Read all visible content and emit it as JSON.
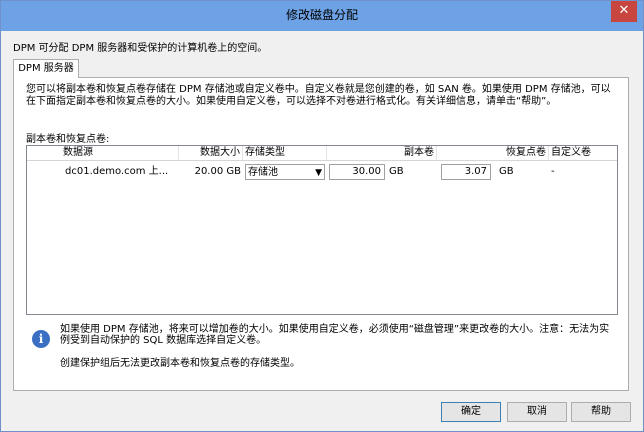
{
  "window": {
    "title": "修改磁盘分配",
    "close_glyph": "✕"
  },
  "description": "DPM 可分配 DPM 服务器和受保护的计算机卷上的空间。",
  "tab": {
    "label": "DPM 服务器"
  },
  "info_paragraph": "您可以将副本卷和恢复点卷存储在 DPM 存储池或自定义卷中。自定义卷就是您创建的卷，如 SAN 卷。如果使用 DPM 存储池，可以在下面指定副本卷和恢复点卷的大小。如果使用自定义卷，可以选择不对卷进行格式化。有关详细信息，请单击“帮助”。",
  "grid": {
    "label": "副本卷和恢复点卷:",
    "columns": [
      "数据源",
      "数据大小",
      "存储类型",
      "副本卷",
      "恢复点卷",
      "自定义卷"
    ],
    "rows": [
      {
        "data_source": "dc01.demo.com 上...",
        "data_size": "20.00 GB",
        "storage_type": "存储池",
        "replica_value": "30.00",
        "replica_unit": "GB",
        "recovery_value": "3.07",
        "recovery_unit": "GB",
        "custom": "-"
      }
    ]
  },
  "notes": {
    "icon": "info-icon",
    "line1": "如果使用 DPM 存储池，将来可以增加卷的大小。如果使用自定义卷，必须使用“磁盘管理”来更改卷的大小。注意：无法为实例受到自动保护的 SQL 数据库选择自定义卷。",
    "line2": "创建保护组后无法更改副本卷和恢复点卷的存储类型。"
  },
  "buttons": {
    "ok": "确定",
    "cancel": "取消",
    "help": "帮助"
  }
}
